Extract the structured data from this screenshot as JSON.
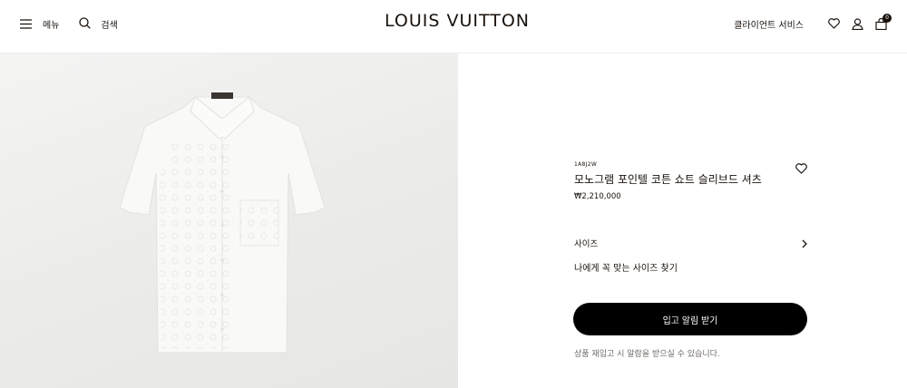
{
  "header": {
    "menu_label": "메뉴",
    "search_label": "검색",
    "logo": "LOUIS VUITTON",
    "client_service": "클라이언트 서비스",
    "cart_count": "0"
  },
  "product": {
    "sku": "1A8J2W",
    "name": "모노그램 포인텔 코튼 쇼트 슬리브드 셔츠",
    "price": "₩2,210,000"
  },
  "size": {
    "label": "사이즈",
    "find_link": "나에게 꼭 맞는 사이즈 찾기"
  },
  "actions": {
    "notify_button": "입고 알림 받기",
    "notify_note": "상품 재입고 시 알람을 받으실 수 있습니다."
  },
  "icons": {
    "menu": "hamburger-menu-icon",
    "search": "search-icon",
    "wishlist": "heart-icon",
    "account": "user-icon",
    "cart": "shopping-bag-icon",
    "size_arrow": "chevron-right-icon"
  }
}
